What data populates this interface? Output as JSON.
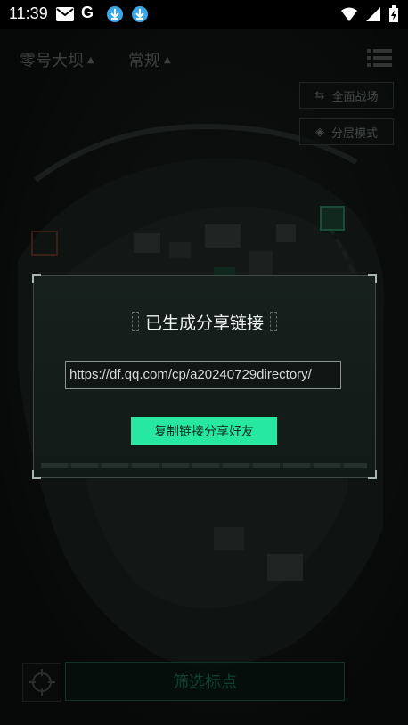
{
  "status_bar": {
    "time": "11:39",
    "google_letter": "G"
  },
  "header": {
    "map_name": "零号大坝",
    "mode_name": "常规"
  },
  "side_buttons": {
    "full_battlefield": "全面战场",
    "layer_mode": "分层模式"
  },
  "dialog": {
    "title": "已生成分享链接",
    "url": "https://df.qq.com/cp/a20240729directory/",
    "copy_button": "复制链接分享好友"
  },
  "bottom": {
    "filter_button": "筛选标点"
  },
  "colors": {
    "accent": "#27e8a1",
    "filter_text": "#1c7a57"
  }
}
